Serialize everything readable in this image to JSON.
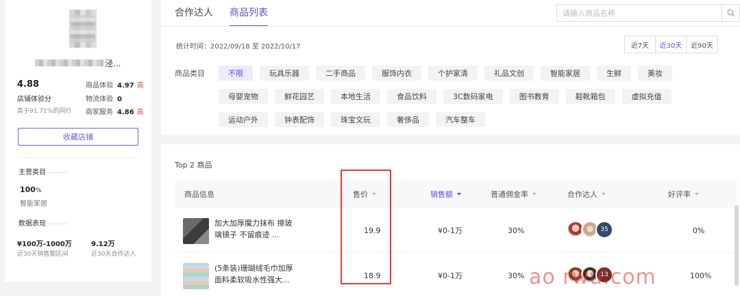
{
  "store": {
    "name_suffix": "泾...",
    "score": "4.88",
    "experience_label": "店铺体验分",
    "percentile_note": "高于91.71%的同行",
    "metrics": [
      {
        "label": "商品体验",
        "value": "4.97",
        "tag": "高"
      },
      {
        "label": "物流体验",
        "value": "0",
        "tag": ""
      },
      {
        "label": "商家服务",
        "value": "4.86",
        "tag": "高"
      }
    ],
    "favorite_button": "收藏店铺",
    "main_category_title": "主营类目",
    "main_category_pct": "100",
    "main_category_pct_unit": "%",
    "main_category_name": "智能家居",
    "data_title": "数据表现",
    "sales_range_value": "¥100万-1000万",
    "sales_range_label": "近30天销售额区间",
    "influencers_value": "9.12万",
    "influencers_label": "近30天合作达人"
  },
  "tabs": [
    {
      "label": "合作达人",
      "active": false
    },
    {
      "label": "商品列表",
      "active": true
    }
  ],
  "search": {
    "placeholder": "请输入商品名称",
    "icon": "search-icon"
  },
  "stat_time": "统计时间：2022/09/18 至 2022/10/17",
  "ranges": [
    {
      "label": "近7天",
      "active": false
    },
    {
      "label": "近30天",
      "active": true
    },
    {
      "label": "近90天",
      "active": false
    }
  ],
  "category_label": "商品类目",
  "categories": [
    {
      "label": "不限",
      "active": true
    },
    {
      "label": "玩具乐器"
    },
    {
      "label": "二手商品"
    },
    {
      "label": "服饰内衣"
    },
    {
      "label": "个护家清"
    },
    {
      "label": "礼品文创"
    },
    {
      "label": "智能家居"
    },
    {
      "label": "生鲜"
    },
    {
      "label": "美妆"
    },
    {
      "label": "母婴宠物"
    },
    {
      "label": "鲜花园艺"
    },
    {
      "label": "本地生活"
    },
    {
      "label": "食品饮料"
    },
    {
      "label": "3C数码家电"
    },
    {
      "label": "图书教育"
    },
    {
      "label": "鞋靴箱包"
    },
    {
      "label": "虚拟充值"
    },
    {
      "label": "运动户外"
    },
    {
      "label": "钟表配饰"
    },
    {
      "label": "珠宝文玩"
    },
    {
      "label": "奢侈品"
    },
    {
      "label": "汽车整车"
    }
  ],
  "table": {
    "title": "Top 2 商品",
    "headers": {
      "info": "商品信息",
      "price": "售价",
      "sales": "销售额",
      "commission": "普通佣金率",
      "influencers": "合作达人",
      "rating": "好评率"
    },
    "rows": [
      {
        "name": "加大加厚魔力抹布 擦玻璃镜子 不留痕迹 ...",
        "price": "19.9",
        "sales": "¥0-1万",
        "commission": "30%",
        "influencer_count": "35",
        "rating": "0%"
      },
      {
        "name": "(5条装)珊瑚绒毛巾加厚面料柔软吸水性强大...",
        "price": "18.9",
        "sales": "¥0-1万",
        "commission": "30%",
        "influencer_count": "13",
        "rating": "100%"
      }
    ]
  },
  "watermark": "ao  rwu.com",
  "colors": {
    "accent": "#5b50d6",
    "highlight": "#e53935",
    "tag": "#e0483a"
  }
}
